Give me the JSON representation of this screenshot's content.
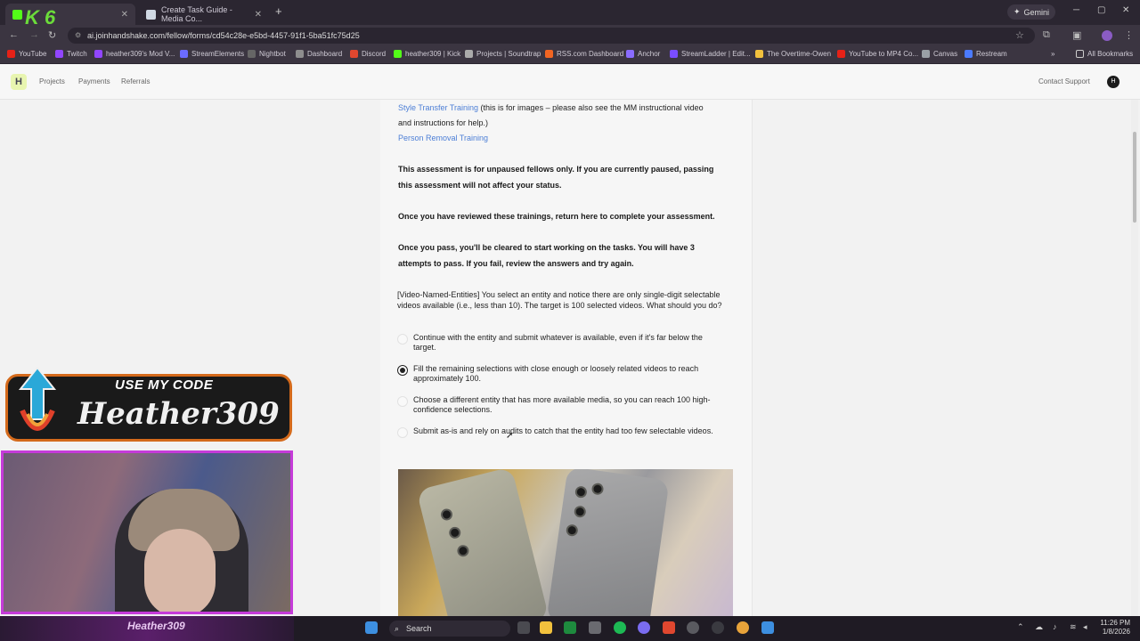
{
  "browser": {
    "tabs": [
      {
        "label": ""
      },
      {
        "label": "Create Task Guide - Media Co..."
      }
    ],
    "gemini_label": "Gemini",
    "url": "ai.joinhandshake.com/fellow/forms/cd54c28e-e5bd-4457-91f1-5ba51fc75d25",
    "bookmarks": [
      {
        "label": "YouTube",
        "color": "#e62117"
      },
      {
        "label": "Twitch",
        "color": "#9146ff"
      },
      {
        "label": "heather309's Mod V...",
        "color": "#9146ff"
      },
      {
        "label": "StreamElements",
        "color": "#6b6bff"
      },
      {
        "label": "Nightbot",
        "color": "#666666"
      },
      {
        "label": "Dashboard",
        "color": "#8e8e8e"
      },
      {
        "label": "Discord",
        "color": "#e0472f"
      },
      {
        "label": "heather309 | Kick",
        "color": "#53fc18"
      },
      {
        "label": "Projects | Soundtrap",
        "color": "#aaaaaa"
      },
      {
        "label": "RSS.com Dashboard",
        "color": "#f26522"
      },
      {
        "label": "Anchor",
        "color": "#8a6cff"
      },
      {
        "label": "StreamLadder | Edit...",
        "color": "#7a4dff"
      },
      {
        "label": "The Overtime-Owen",
        "color": "#f2c13d"
      },
      {
        "label": "YouTube to MP4 Co...",
        "color": "#e62117"
      },
      {
        "label": "Canvas",
        "color": "#9aa0a6"
      },
      {
        "label": "Restream",
        "color": "#4b7bff"
      }
    ],
    "all_bookmarks": "All Bookmarks"
  },
  "app": {
    "nav": [
      "Projects",
      "Payments",
      "Referrals"
    ],
    "contact": "Contact Support",
    "avatar_initial": "H"
  },
  "content": {
    "link1": "Style Transfer Training",
    "link1_note_a": " (this is for images – please also see the MM instructional video",
    "link1_note_b": "and instructions for help.)",
    "link2": "Person Removal Training",
    "notice1_a": "This assessment is for unpaused fellows only. If you are currently paused, passing",
    "notice1_b": "this assessment will not affect your status.",
    "notice2": "Once you have reviewed these trainings, return here to complete your assessment.",
    "notice3_a": "Once you pass, you'll be cleared to start working on the tasks. You will have 3",
    "notice3_b": "attempts to pass. If you fail, review the answers and try again.",
    "question": "[Video-Named-Entities] You select an entity and notice there are only single-digit selectable videos available (i.e., less than 10). The target is 100 selected videos. What should you do?",
    "options": [
      {
        "label": "Continue with the entity and submit whatever is available, even if it's far below the target.",
        "selected": false
      },
      {
        "label": "Fill the remaining selections with close enough or loosely related videos to reach approximately 100.",
        "selected": true
      },
      {
        "label": "Choose a different entity that has more available media, so you can reach 100 high-confidence selections.",
        "selected": false
      },
      {
        "label": "Submit as-is and rely on audits to catch that the entity had too few selectable videos.",
        "selected": false
      }
    ]
  },
  "overlay": {
    "promo_top": "USE MY CODE",
    "promo_code": "Heather309",
    "corner_badge": "K 6",
    "taskbar_signature": "Heather309"
  },
  "taskbar": {
    "search": "Search",
    "time": "11:26 PM",
    "date": "1/8/2026"
  }
}
